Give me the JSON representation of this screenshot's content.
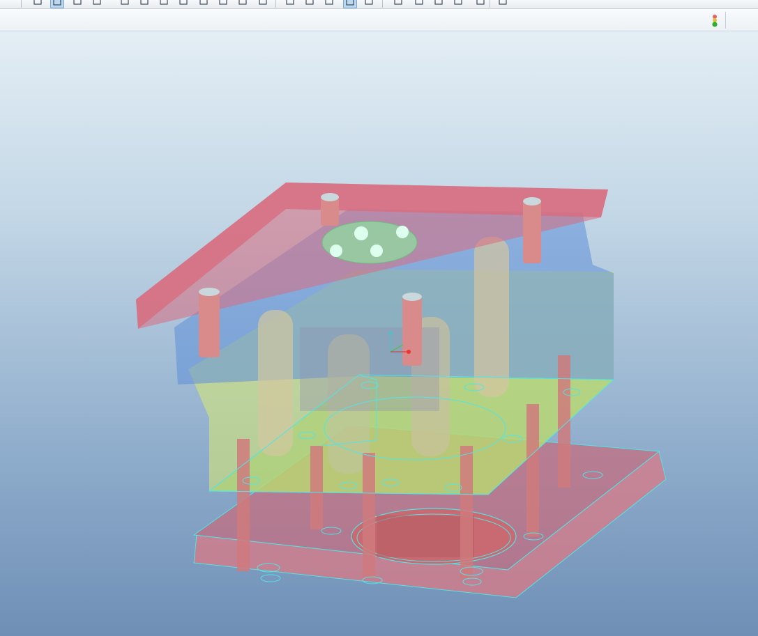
{
  "toolbar": {
    "buttons": [
      {
        "name": "sketch-view-icon",
        "active": false
      },
      {
        "name": "datum-display-icon",
        "active": true
      },
      {
        "name": "spin-center-icon",
        "active": false
      },
      {
        "name": "shading-icon",
        "active": false
      },
      {
        "name": "repaint-icon",
        "active": false
      },
      {
        "name": "zoom-in-icon",
        "active": false
      },
      {
        "name": "zoom-out-icon",
        "active": false
      },
      {
        "name": "zoom-fit-icon",
        "active": false
      },
      {
        "name": "saved-views-icon",
        "active": false
      },
      {
        "name": "reorient-icon",
        "active": false
      },
      {
        "name": "layers-icon",
        "active": false
      },
      {
        "name": "appearance-icon",
        "active": false
      },
      {
        "name": "wireframe-icon",
        "active": false
      },
      {
        "name": "hidden-line-icon",
        "active": false
      },
      {
        "name": "no-hidden-icon",
        "active": false
      },
      {
        "name": "shaded-icon",
        "active": true
      },
      {
        "name": "enhanced-realism-icon",
        "active": false
      },
      {
        "name": "datum-planes-icon",
        "active": false
      },
      {
        "name": "datum-axes-icon",
        "active": false
      },
      {
        "name": "datum-points-icon",
        "active": false
      },
      {
        "name": "coordinate-systems-icon",
        "active": false
      },
      {
        "name": "annotations-icon",
        "active": false
      },
      {
        "name": "spin-icon",
        "active": false
      }
    ]
  },
  "status": {
    "regen_light": "green"
  },
  "colors": {
    "top_plate": "#d96b7d",
    "cavity_plate": "#5f8fd8",
    "core_plate": "#d2e37a",
    "bottom_plate": "#d97a86",
    "wireframe": "#4fe6e6",
    "pin": "#d98a8a",
    "ejector": "#8fdca0"
  }
}
